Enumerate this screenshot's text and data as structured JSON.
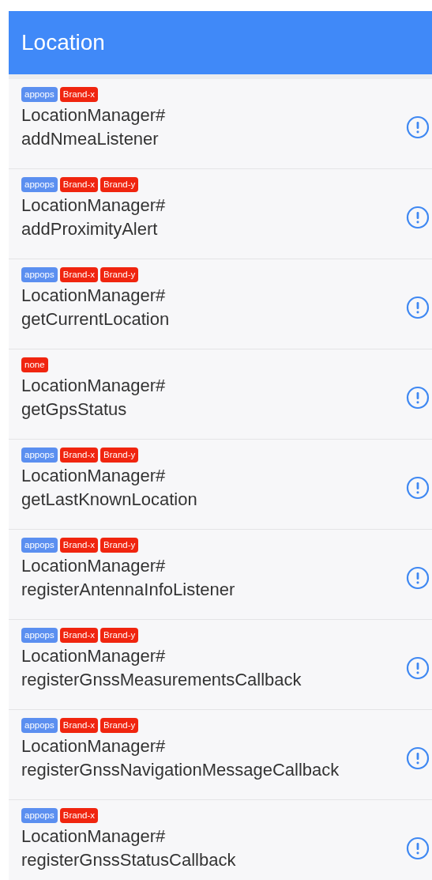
{
  "app_bar": {
    "title": "Location"
  },
  "items": [
    {
      "tags": [
        {
          "label": "appops",
          "color": "#5b8ff0"
        },
        {
          "label": "Brand-x",
          "color": "#f0250f"
        }
      ],
      "lines": [
        "LocationManager#",
        "addNmeaListener"
      ]
    },
    {
      "tags": [
        {
          "label": "appops",
          "color": "#5b8ff0"
        },
        {
          "label": "Brand-x",
          "color": "#f0250f"
        },
        {
          "label": "Brand-y",
          "color": "#f0250f"
        }
      ],
      "lines": [
        "LocationManager#",
        "addProximityAlert"
      ]
    },
    {
      "tags": [
        {
          "label": "appops",
          "color": "#5b8ff0"
        },
        {
          "label": "Brand-x",
          "color": "#f0250f"
        },
        {
          "label": "Brand-y",
          "color": "#f0250f"
        }
      ],
      "lines": [
        "LocationManager#",
        "getCurrentLocation"
      ]
    },
    {
      "tags": [
        {
          "label": "none",
          "color": "#f0250f"
        }
      ],
      "lines": [
        "LocationManager#",
        "getGpsStatus"
      ]
    },
    {
      "tags": [
        {
          "label": "appops",
          "color": "#5b8ff0"
        },
        {
          "label": "Brand-x",
          "color": "#f0250f"
        },
        {
          "label": "Brand-y",
          "color": "#f0250f"
        }
      ],
      "lines": [
        "LocationManager#",
        "getLastKnownLocation"
      ]
    },
    {
      "tags": [
        {
          "label": "appops",
          "color": "#5b8ff0"
        },
        {
          "label": "Brand-x",
          "color": "#f0250f"
        },
        {
          "label": "Brand-y",
          "color": "#f0250f"
        }
      ],
      "lines": [
        "LocationManager#",
        "registerAntennaInfoListener"
      ]
    },
    {
      "tags": [
        {
          "label": "appops",
          "color": "#5b8ff0"
        },
        {
          "label": "Brand-x",
          "color": "#f0250f"
        },
        {
          "label": "Brand-y",
          "color": "#f0250f"
        }
      ],
      "lines": [
        "LocationManager#",
        "registerGnssMeasurementsCallback"
      ]
    },
    {
      "tags": [
        {
          "label": "appops",
          "color": "#5b8ff0"
        },
        {
          "label": "Brand-x",
          "color": "#f0250f"
        },
        {
          "label": "Brand-y",
          "color": "#f0250f"
        }
      ],
      "lines": [
        "LocationManager#",
        "registerGnssNavigationMessageCallback"
      ]
    },
    {
      "tags": [
        {
          "label": "appops",
          "color": "#5b8ff0"
        },
        {
          "label": "Brand-x",
          "color": "#f0250f"
        }
      ],
      "lines": [
        "LocationManager#",
        "registerGnssStatusCallback"
      ]
    }
  ]
}
